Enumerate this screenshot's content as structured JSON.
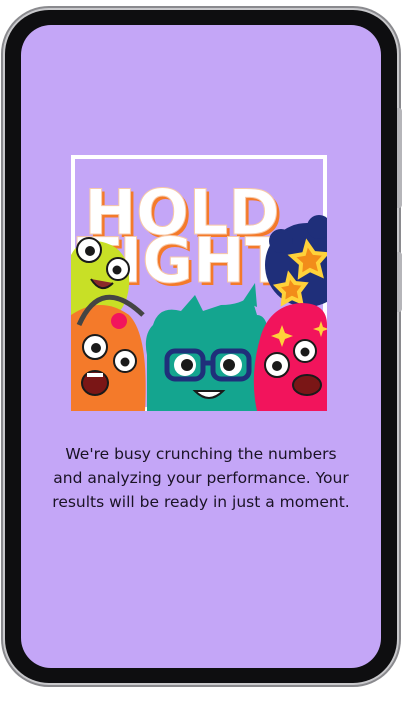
{
  "illustration": {
    "headline_line1": "HOLD",
    "headline_line2": "TIGHT",
    "icon": "monsters-illustration"
  },
  "message": {
    "text": "We're busy crunching the numbers and analyzing your performance. Your results will be ready in just a moment."
  },
  "colors": {
    "screen_background": "#c4a6f7",
    "text": "#1a1325",
    "monster_green": "#c8e026",
    "monster_orange": "#f47a2a",
    "monster_teal": "#14a58f",
    "monster_pink": "#f2145c",
    "monster_navy": "#1f2f7a",
    "star_yellow": "#ffd23a"
  }
}
